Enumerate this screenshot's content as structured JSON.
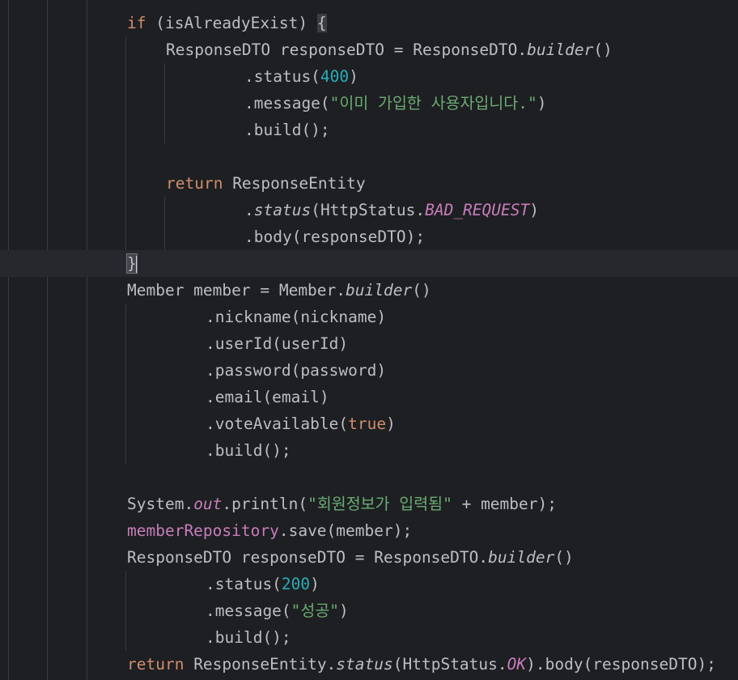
{
  "lines": {
    "l1": {
      "kw": "if",
      "text": " (isAlreadyExist) ",
      "brace": "{"
    },
    "l2": {
      "a": "ResponseDTO responseDTO = ResponseDTO.",
      "b": "builder",
      "c": "()"
    },
    "l3": {
      "a": ".status(",
      "num": "400",
      "c": ")"
    },
    "l4": {
      "a": ".message(",
      "str": "\"이미 가입한 사용자입니다.\"",
      "c": ")"
    },
    "l5": {
      "a": ".build();"
    },
    "l7": {
      "kw": "return",
      "a": " ResponseEntity"
    },
    "l8": {
      "a": ".",
      "b": "status",
      "c": "(HttpStatus.",
      "const": "BAD_REQUEST",
      "d": ")"
    },
    "l9": {
      "a": ".body(responseDTO);"
    },
    "l10": {
      "brace": "}"
    },
    "l11": {
      "a": "Member member = Member.",
      "b": "builder",
      "c": "()"
    },
    "l12": {
      "a": ".nickname(nickname)"
    },
    "l13": {
      "a": ".userId(userId)"
    },
    "l14": {
      "a": ".password(password)"
    },
    "l15": {
      "a": ".email(email)"
    },
    "l16": {
      "a": ".voteAvailable(",
      "kw": "true",
      "c": ")"
    },
    "l17": {
      "a": ".build();"
    },
    "l19": {
      "a": "System.",
      "field": "out",
      "b": ".println(",
      "str": "\"회원정보가 입력됨\"",
      "c": " + member);"
    },
    "l20": {
      "field": "memberRepository",
      "a": ".save(member);"
    },
    "l21": {
      "a": "ResponseDTO responseDTO = ResponseDTO.",
      "b": "builder",
      "c": "()"
    },
    "l22": {
      "a": ".status(",
      "num": "200",
      "c": ")"
    },
    "l23": {
      "a": ".message(",
      "str": "\"성공\"",
      "c": ")"
    },
    "l24": {
      "a": ".build();"
    },
    "l25": {
      "kw": "return",
      "a": " ResponseEntity.",
      "b": "status",
      "c": "(HttpStatus.",
      "const": "OK",
      "d": ").body(responseDTO);"
    }
  },
  "colors": {
    "background": "#1e1f22",
    "keyword": "#cf8e6d",
    "number": "#2aacb8",
    "string": "#6aab73",
    "field_constant": "#c77dbb",
    "default_text": "#bcbec4"
  }
}
